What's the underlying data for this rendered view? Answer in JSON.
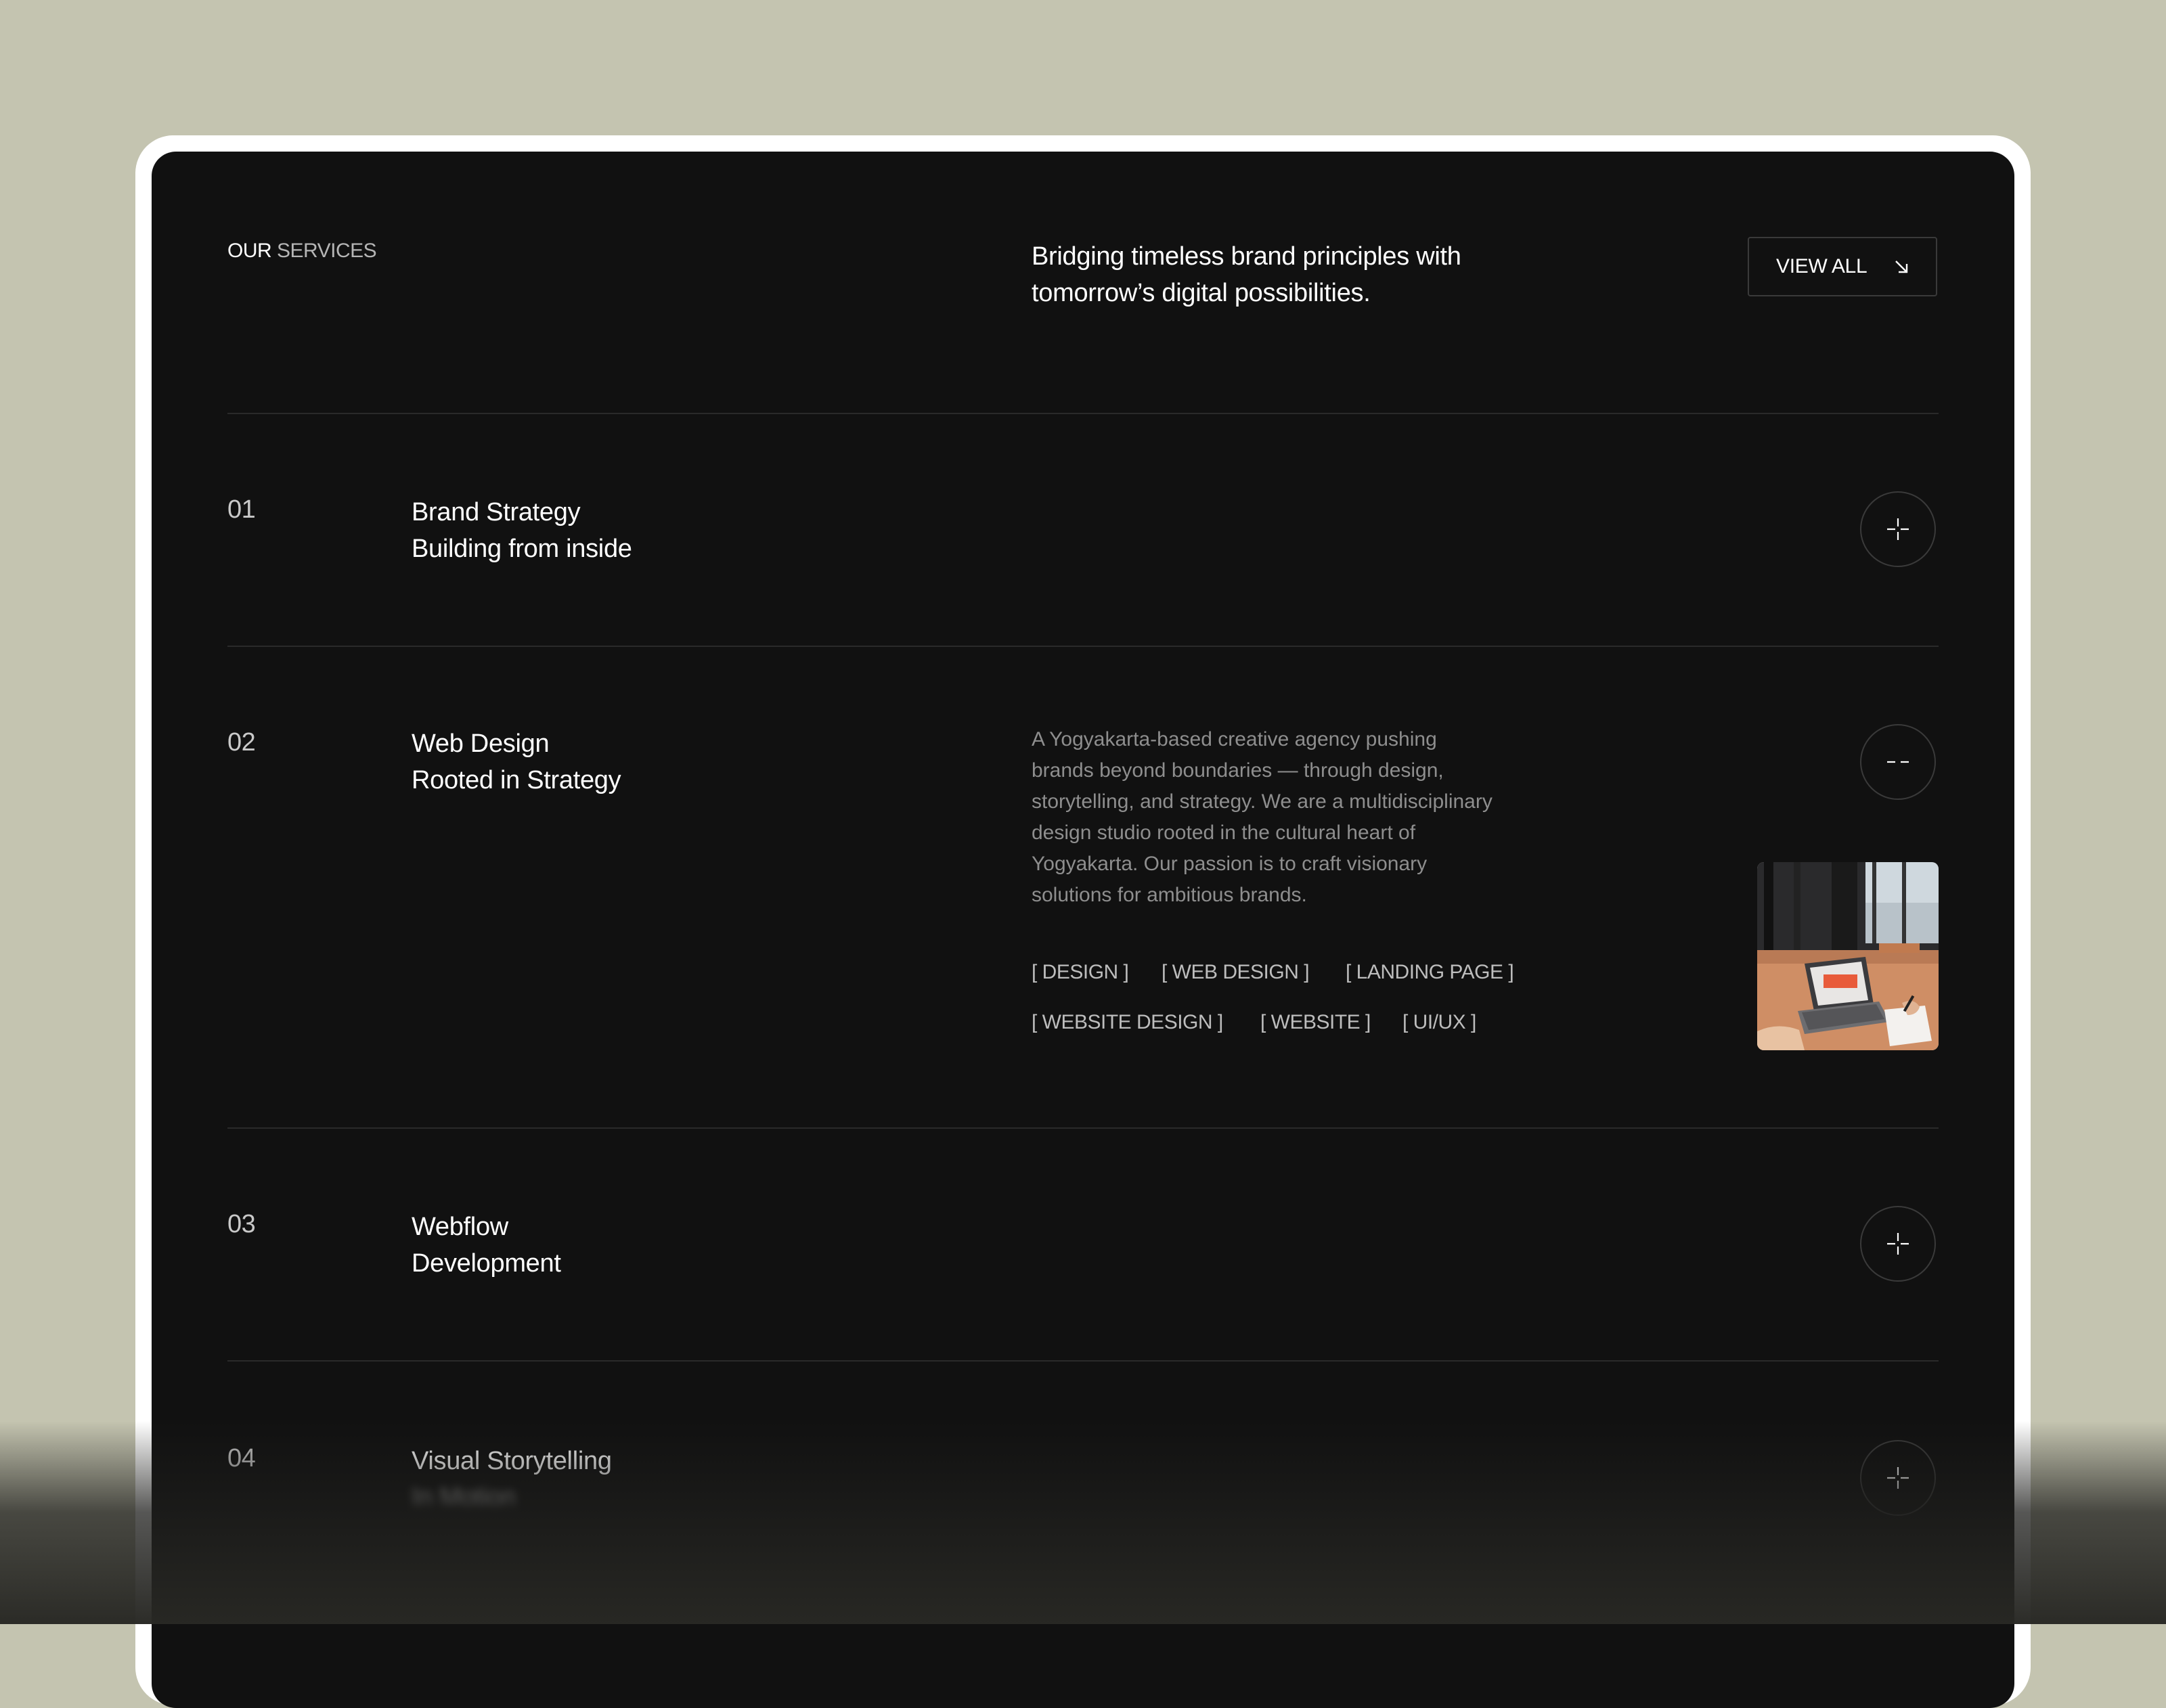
{
  "header": {
    "section_label_1": "OUR",
    "section_label_2": "SERVICES",
    "tagline_line1": "Bridging timeless brand principles with",
    "tagline_line2": "tomorrow’s digital possibilities.",
    "view_all_label": "VIEW ALL"
  },
  "services": [
    {
      "number": "01",
      "title_line1": "Brand Strategy",
      "title_line2": "Building from inside",
      "expanded": false,
      "toggle_icon": "plus-icon"
    },
    {
      "number": "02",
      "title_line1": "Web Design",
      "title_line2": "Rooted in Strategy",
      "expanded": true,
      "toggle_icon": "minus-icon"
    },
    {
      "number": "03",
      "title_line1": "Webflow",
      "title_line2": "Development",
      "expanded": false,
      "toggle_icon": "plus-icon"
    },
    {
      "number": "04",
      "title_line1": "Visual Storytelling",
      "title_line2": "In Motion",
      "expanded": false,
      "toggle_icon": "plus-icon"
    }
  ],
  "expanded": {
    "description_lines": [
      "A Yogyakarta-based creative agency pushing",
      "brands beyond boundaries — through design,",
      "storytelling, and strategy. We are a multidisciplinary",
      "design studio rooted in the cultural heart of",
      "Yogyakarta. Our passion is to craft visionary",
      "solutions for ambitious brands."
    ],
    "tags": [
      "[ DESIGN ]",
      "[ WEB DESIGN ]",
      "[ LANDING PAGE ]",
      "[ WEBSITE DESIGN ]",
      "[ WEBSITE ]",
      "[ UI/UX ]"
    ],
    "thumbnail_icon": "laptop-workspace-photo"
  },
  "colors": {
    "page_background": "#c4c4b0",
    "panel_background": "#111111",
    "frame": "#ffffff",
    "divider": "#2a2a2a",
    "text_primary": "#ffffff",
    "text_muted": "#8e8e8e"
  }
}
